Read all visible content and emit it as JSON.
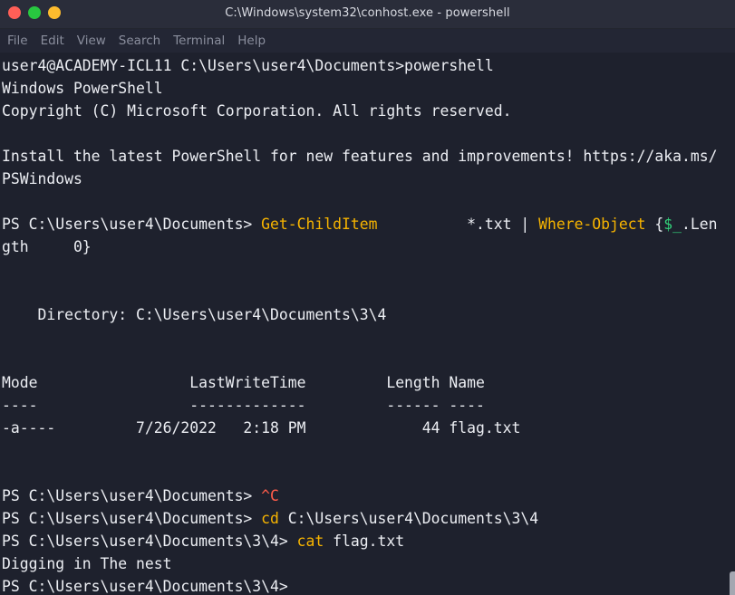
{
  "window": {
    "title": "C:\\Windows\\system32\\conhost.exe - powershell"
  },
  "menu": {
    "items": [
      "File",
      "Edit",
      "View",
      "Search",
      "Terminal",
      "Help"
    ]
  },
  "terminal": {
    "lines": [
      {
        "segments": [
          {
            "text": "user4@ACADEMY-ICL11 C:\\Users\\user4\\Documents>powershell",
            "color": "white"
          }
        ]
      },
      {
        "segments": [
          {
            "text": "Windows PowerShell",
            "color": "white"
          }
        ]
      },
      {
        "segments": [
          {
            "text": "Copyright (C) Microsoft Corporation. All rights reserved.",
            "color": "white"
          }
        ]
      },
      {
        "segments": [
          {
            "text": "",
            "color": "white"
          }
        ]
      },
      {
        "segments": [
          {
            "text": "Install the latest PowerShell for new features and improvements! https://aka.ms/",
            "color": "white"
          }
        ]
      },
      {
        "segments": [
          {
            "text": "PSWindows",
            "color": "white"
          }
        ]
      },
      {
        "segments": [
          {
            "text": "",
            "color": "white"
          }
        ]
      },
      {
        "segments": [
          {
            "text": "PS C:\\Users\\user4\\Documents> ",
            "color": "white"
          },
          {
            "text": "Get-ChildItem",
            "color": "yellow"
          },
          {
            "text": "          *.txt | ",
            "color": "white"
          },
          {
            "text": "Where-Object",
            "color": "yellow"
          },
          {
            "text": " {",
            "color": "white"
          },
          {
            "text": "$_",
            "color": "green"
          },
          {
            "text": ".Len",
            "color": "white"
          }
        ]
      },
      {
        "segments": [
          {
            "text": "gth     0}",
            "color": "white"
          }
        ]
      },
      {
        "segments": [
          {
            "text": "",
            "color": "white"
          }
        ]
      },
      {
        "segments": [
          {
            "text": "",
            "color": "white"
          }
        ]
      },
      {
        "segments": [
          {
            "text": "    Directory: C:\\Users\\user4\\Documents\\3\\4",
            "color": "white"
          }
        ]
      },
      {
        "segments": [
          {
            "text": "",
            "color": "white"
          }
        ]
      },
      {
        "segments": [
          {
            "text": "",
            "color": "white"
          }
        ]
      },
      {
        "segments": [
          {
            "text": "Mode                 LastWriteTime         Length Name",
            "color": "white"
          }
        ]
      },
      {
        "segments": [
          {
            "text": "----                 -------------         ------ ----",
            "color": "white"
          }
        ]
      },
      {
        "segments": [
          {
            "text": "-a----         7/26/2022   2:18 PM             44 flag.txt",
            "color": "white"
          }
        ]
      },
      {
        "segments": [
          {
            "text": "",
            "color": "white"
          }
        ]
      },
      {
        "segments": [
          {
            "text": "",
            "color": "white"
          }
        ]
      },
      {
        "segments": [
          {
            "text": "PS C:\\Users\\user4\\Documents> ",
            "color": "white"
          },
          {
            "text": "^C",
            "color": "red"
          }
        ]
      },
      {
        "segments": [
          {
            "text": "PS C:\\Users\\user4\\Documents> ",
            "color": "white"
          },
          {
            "text": "cd",
            "color": "yellow"
          },
          {
            "text": " C:\\Users\\user4\\Documents\\3\\4",
            "color": "white"
          }
        ]
      },
      {
        "segments": [
          {
            "text": "PS C:\\Users\\user4\\Documents\\3\\4> ",
            "color": "white"
          },
          {
            "text": "cat",
            "color": "yellow"
          },
          {
            "text": " flag.txt",
            "color": "white"
          }
        ]
      },
      {
        "segments": [
          {
            "text": "Digging in The nest",
            "color": "white"
          }
        ]
      },
      {
        "segments": [
          {
            "text": "PS C:\\Users\\user4\\Documents\\3\\4> ",
            "color": "white"
          }
        ]
      }
    ]
  },
  "colors": {
    "background": "#1e212d",
    "titlebar": "#2a2d3a",
    "command": "#f7b400",
    "interrupt": "#ff5c4a",
    "variable": "#33d17a",
    "text": "#eceef3"
  }
}
